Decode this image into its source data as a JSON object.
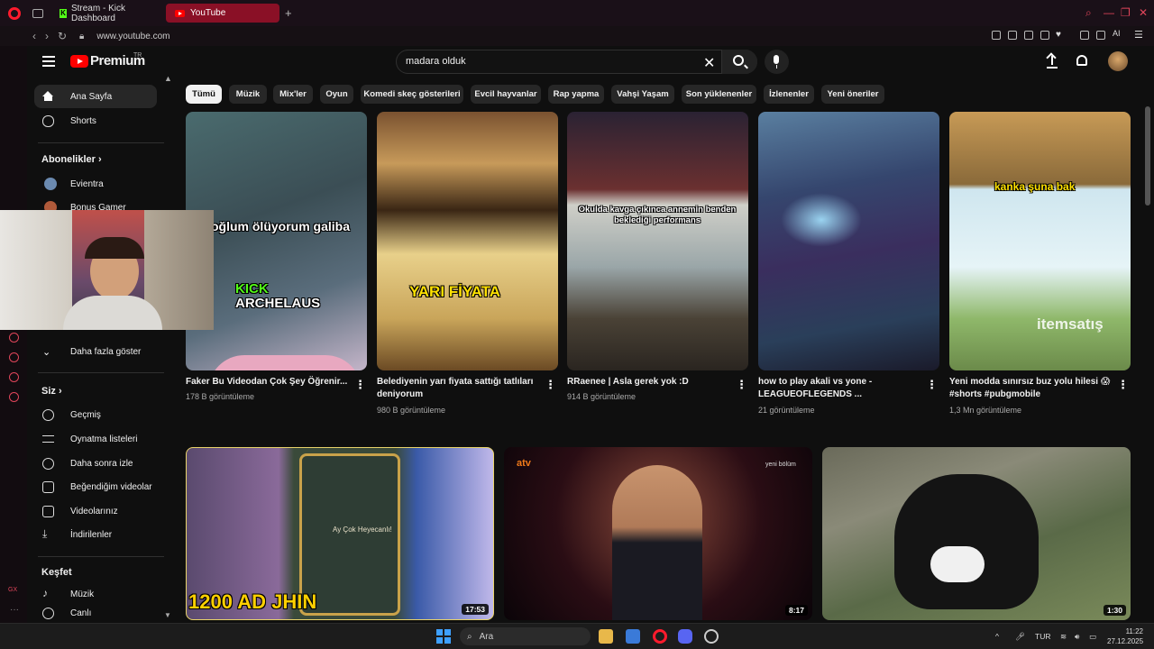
{
  "browser": {
    "tabs": [
      {
        "label": "Stream - Kick Dashboard"
      },
      {
        "label": "YouTube"
      }
    ],
    "url": "www.youtube.com",
    "ai_label": "AI"
  },
  "header": {
    "logo_text": "Premium",
    "region": "TR",
    "search_value": "madara olduk",
    "search_placeholder": "Ara"
  },
  "sidebar": {
    "main": [
      {
        "label": "Ana Sayfa"
      },
      {
        "label": "Shorts"
      }
    ],
    "subscriptions_heading": "Abonelikler",
    "channels": [
      {
        "label": "Evientra"
      },
      {
        "label": "Bonus Gamer"
      }
    ],
    "show_more": "Daha fazla göster",
    "you_heading": "Siz",
    "you_items": [
      {
        "label": "Geçmiş"
      },
      {
        "label": "Oynatma listeleri"
      },
      {
        "label": "Daha sonra izle"
      },
      {
        "label": "Beğendiğim videolar"
      },
      {
        "label": "Videolarınız"
      },
      {
        "label": "İndirilenler"
      }
    ],
    "explore_heading": "Keşfet",
    "explore_items": [
      {
        "label": "Müzik"
      },
      {
        "label": "Canlı"
      }
    ]
  },
  "chips": [
    "Tümü",
    "Müzik",
    "Mix'ler",
    "Oyun",
    "Komedi skeç gösterileri",
    "Evcil hayvanlar",
    "Rap yapma",
    "Vahşi Yaşam",
    "Son yüklenenler",
    "İzlenenler",
    "Yeni öneriler"
  ],
  "shorts": [
    {
      "title": "Faker Bu Videodan Çok Şey Öğrenir...",
      "views": "178 B görüntüleme",
      "overlay": "oğlum ölüyorum galiba",
      "overlay2": "KICK",
      "overlay3": "ARCHELAUS"
    },
    {
      "title": "Belediyenin yarı fiyata sattığı tatlıları deniyorum",
      "views": "980 B görüntüleme",
      "overlay": "YARI FİYATA"
    },
    {
      "title": "RRaenee | Asla gerek yok :D",
      "views": "914 B görüntüleme",
      "overlay": "Okulda kavga çıkınca annemin benden beklediği performans"
    },
    {
      "title": "how to play akali vs yone - LEAGUEOFLEGENDS ...",
      "views": "21 görüntüleme"
    },
    {
      "title": "Yeni modda sınırsız buz yolu hilesi 😱 #shorts #pubgmobile",
      "views": "1,3 Mn görüntüleme",
      "overlay": "kanka şuna bak"
    }
  ],
  "videos": [
    {
      "duration": "17:53",
      "overlay": "1200 AD JHIN",
      "card_title": "Ay Çok Heyecanlı!"
    },
    {
      "duration": "8:17",
      "badge": "atv",
      "badge2": "yeni bölüm"
    },
    {
      "duration": "1:30"
    }
  ],
  "watermark": "itemsatış",
  "taskbar": {
    "search_label": "Ara",
    "lang": "TUR",
    "time": "11:22",
    "date": "27.12.2025"
  },
  "colors": {
    "accent": "#ff0000",
    "background": "#0f0f0f",
    "chip_bg": "#272727",
    "opera_red": "#ff1b2d"
  }
}
